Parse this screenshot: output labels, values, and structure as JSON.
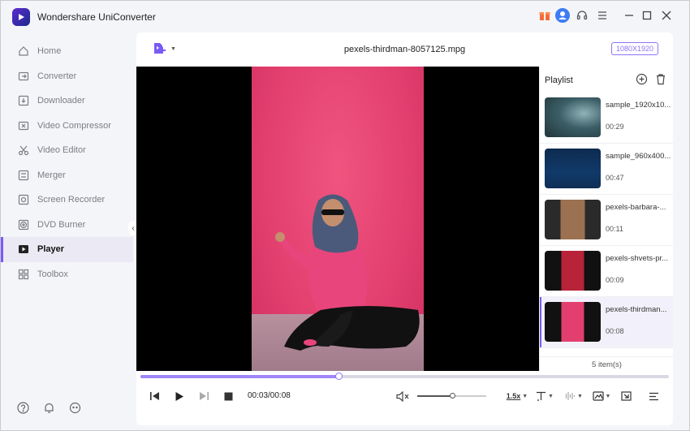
{
  "app": {
    "title": "Wondershare UniConverter"
  },
  "sidebar": {
    "items": [
      {
        "label": "Home",
        "icon": "home-icon",
        "active": false
      },
      {
        "label": "Converter",
        "icon": "converter-icon",
        "active": false
      },
      {
        "label": "Downloader",
        "icon": "downloader-icon",
        "active": false
      },
      {
        "label": "Video Compressor",
        "icon": "compressor-icon",
        "active": false
      },
      {
        "label": "Video Editor",
        "icon": "scissors-icon",
        "active": false
      },
      {
        "label": "Merger",
        "icon": "merger-icon",
        "active": false
      },
      {
        "label": "Screen Recorder",
        "icon": "screen-recorder-icon",
        "active": false
      },
      {
        "label": "DVD Burner",
        "icon": "disc-icon",
        "active": false
      },
      {
        "label": "Player",
        "icon": "player-icon",
        "active": true
      },
      {
        "label": "Toolbox",
        "icon": "toolbox-icon",
        "active": false
      }
    ]
  },
  "player": {
    "file_name": "pexels-thirdman-8057125.mpg",
    "resolution": "1080X1920",
    "current_time": "00:03/00:08",
    "progress": 0.375,
    "volume": 0.5,
    "speed": "1.5x"
  },
  "playlist": {
    "title": "Playlist",
    "count": "5 item(s)",
    "items": [
      {
        "name": "sample_1920x10...",
        "duration": "00:29",
        "active": false
      },
      {
        "name": "sample_960x400...",
        "duration": "00:47",
        "active": false
      },
      {
        "name": "pexels-barbara-...",
        "duration": "00:11",
        "active": false
      },
      {
        "name": "pexels-shvets-pr...",
        "duration": "00:09",
        "active": false
      },
      {
        "name": "pexels-thirdman...",
        "duration": "00:08",
        "active": true
      }
    ]
  },
  "colors": {
    "accent": "#7a5af5",
    "video_bg": "#e23f6e"
  }
}
